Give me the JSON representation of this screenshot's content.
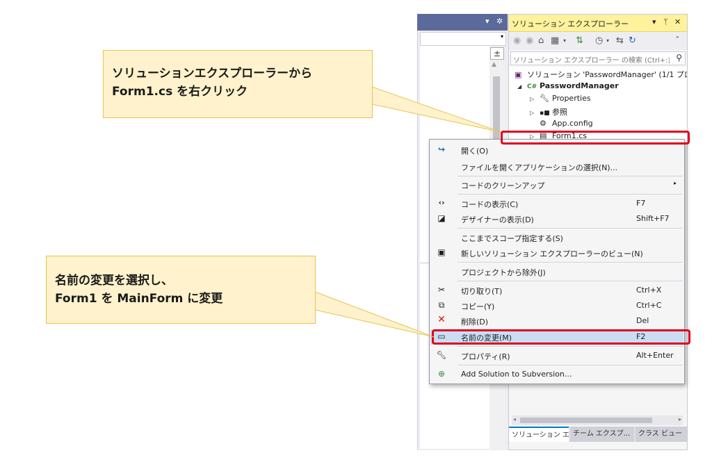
{
  "solution_explorer": {
    "title": "ソリューション エクスプローラー",
    "title_controls": [
      "▾",
      "ᛘ",
      "✕"
    ],
    "search_placeholder": "ソリューション エクスプローラー の検索 (Ctrl+:)",
    "tree": [
      {
        "label": "ソリューション 'PasswordManager' (1/1 プロジ",
        "icon": "solution-icon"
      },
      {
        "label": "PasswordManager",
        "icon": "csharp-project-icon"
      },
      {
        "label": "Properties",
        "icon": "wrench-icon"
      },
      {
        "label": "参照",
        "icon": "references-icon"
      },
      {
        "label": "App.config",
        "icon": "config-file-icon"
      },
      {
        "label": "Form1.cs",
        "icon": "form-file-icon"
      }
    ],
    "tabs": [
      "ソリューション エ...",
      "チーム エクスプ...",
      "クラス ビュー"
    ]
  },
  "context_menu": {
    "items": [
      {
        "label": "開く(O)",
        "shortcut": "",
        "icon": "open-arrow-icon"
      },
      {
        "label": "ファイルを開くアプリケーションの選択(N)...",
        "shortcut": "",
        "icon": ""
      },
      {
        "label": "コードのクリーンアップ",
        "shortcut": "",
        "icon": "",
        "submenu": "▸"
      },
      {
        "label": "コードの表示(C)",
        "shortcut": "F7",
        "icon": "code-view-icon"
      },
      {
        "label": "デザイナーの表示(D)",
        "shortcut": "Shift+F7",
        "icon": "designer-icon"
      },
      {
        "label": "ここまでスコープ指定する(S)",
        "shortcut": "",
        "icon": ""
      },
      {
        "label": "新しいソリューション エクスプローラーのビュー(N)",
        "shortcut": "",
        "icon": "new-view-icon"
      },
      {
        "label": "プロジェクトから除外(J)",
        "shortcut": "",
        "icon": ""
      },
      {
        "label": "切り取り(T)",
        "shortcut": "Ctrl+X",
        "icon": "scissors-icon"
      },
      {
        "label": "コピー(Y)",
        "shortcut": "Ctrl+C",
        "icon": "copy-icon"
      },
      {
        "label": "削除(D)",
        "shortcut": "Del",
        "icon": "delete-x-icon"
      },
      {
        "label": "名前の変更(M)",
        "shortcut": "F2",
        "icon": "rename-icon"
      },
      {
        "label": "プロパティ(R)",
        "shortcut": "Alt+Enter",
        "icon": "wrench-icon"
      },
      {
        "label": "Add Solution to Subversion...",
        "shortcut": "",
        "icon": "subversion-icon"
      }
    ]
  },
  "callouts": {
    "first": {
      "line1": "ソリューションエクスプローラーから",
      "line2": "Form1.cs を右クリック"
    },
    "second": {
      "line1": "名前の変更を選択し、",
      "line2": "Form1 を MainForm に変更"
    }
  },
  "colors": {
    "highlight_outline": "#e0001b",
    "callout_bg": "#fff2cc",
    "se_title_bg": "#fff29d"
  }
}
